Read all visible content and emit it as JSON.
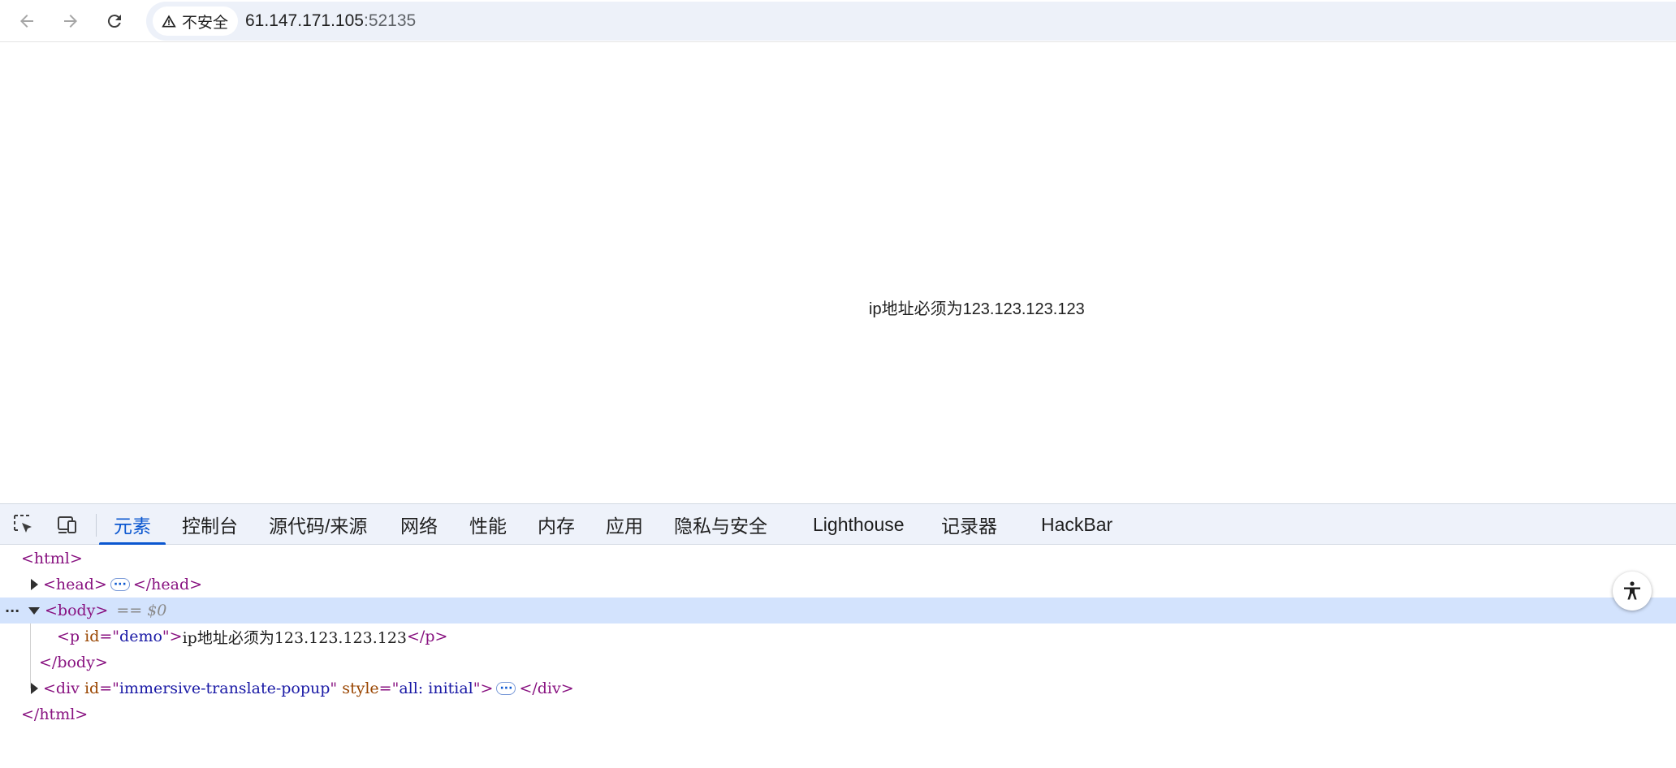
{
  "browser": {
    "security_label": "不安全",
    "url_host": "61.147.171.105",
    "url_port": ":52135"
  },
  "page": {
    "demo_text": "ip地址必须为123.123.123.123"
  },
  "devtools": {
    "tabs": [
      {
        "label": "元素",
        "active": true
      },
      {
        "label": "控制台",
        "active": false
      },
      {
        "label": "源代码/来源",
        "active": false
      },
      {
        "label": "网络",
        "active": false
      },
      {
        "label": "性能",
        "active": false
      },
      {
        "label": "内存",
        "active": false
      },
      {
        "label": "应用",
        "active": false
      },
      {
        "label": "隐私与安全",
        "active": false
      },
      {
        "label": "Lighthouse",
        "active": false
      },
      {
        "label": "记录器",
        "active": false
      },
      {
        "label": "HackBar",
        "active": false
      }
    ],
    "dom": {
      "html_open": "<html>",
      "head_open": "<head>",
      "head_close": "</head>",
      "body_open": "<body>",
      "selected_marker": "== $0",
      "p_tag_open_start": "<p",
      "p_attr_name": " id",
      "p_attr_eq": "=\"",
      "p_attr_value": "demo",
      "p_attr_end": "\">",
      "p_text": "ip地址必须为123.123.123.123",
      "p_close": "</p>",
      "body_close": "</body>",
      "div_open_start": "<div",
      "div_attr1_name": " id",
      "div_attr1_eq": "=\"",
      "div_attr1_value": "immersive-translate-popup",
      "div_attr1_end": "\"",
      "div_attr2_name": " style",
      "div_attr2_eq": "=\"",
      "div_attr2_value": "all: initial",
      "div_attr2_end": "\">",
      "div_close": "</div>",
      "html_close": "</html>",
      "ellipsis": "···",
      "row_menu": "···"
    }
  },
  "colors": {
    "accent": "#0b57d0",
    "tag": "#881280",
    "attr_name": "#994500",
    "attr_value": "#1a1aa6",
    "selected_row": "#d3e3fd"
  }
}
